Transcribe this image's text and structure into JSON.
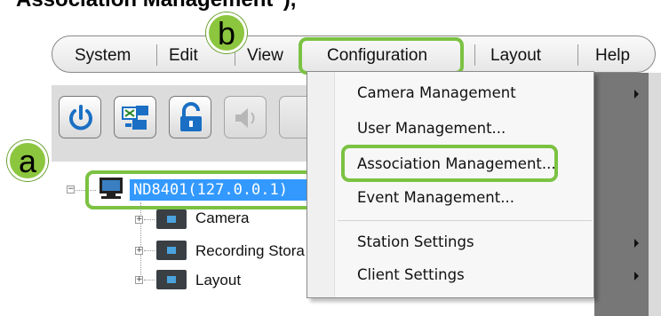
{
  "caption": "Association Management\"),",
  "menubar": {
    "items": [
      "System",
      "Edit",
      "View",
      "Configuration",
      "Layout",
      "Help"
    ]
  },
  "callouts": {
    "a": "a",
    "b": "b"
  },
  "toolbar": {
    "buttons": [
      "power-icon",
      "network-computer-icon",
      "lock-icon",
      "speaker-icon"
    ]
  },
  "tree": {
    "root_label": "ND8401(127.0.0.1)",
    "children": [
      "Camera",
      "Recording Stora",
      "Layout"
    ]
  },
  "dropdown": {
    "items": [
      {
        "label": "Camera Management",
        "submenu": true
      },
      {
        "label": "User Management...",
        "submenu": false
      },
      {
        "label": "Association Management...",
        "submenu": false
      },
      {
        "label": "Event Management...",
        "submenu": false
      },
      {
        "label": "Station Settings",
        "submenu": true
      },
      {
        "label": "Client Settings",
        "submenu": true
      }
    ]
  },
  "colors": {
    "highlight": "#7bc242",
    "callout": "#8cc63f",
    "selection": "#3399ff"
  }
}
